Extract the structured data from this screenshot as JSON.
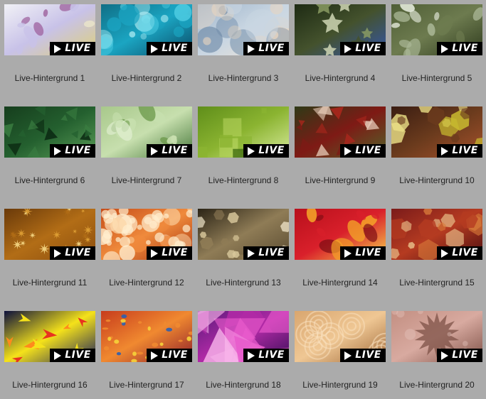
{
  "badge_label": "LIVE",
  "items": [
    {
      "label": "Live-Hintergrund 1",
      "theme": "pastel-leaves",
      "colors": [
        "#f1f1f6",
        "#c8c2e8",
        "#f0eccb",
        "#a26aa4",
        "#ddd07a"
      ]
    },
    {
      "label": "Live-Hintergrund 2",
      "theme": "cyan-bokeh",
      "colors": [
        "#0f6f86",
        "#1ba5c2",
        "#5ad6ea",
        "#bdf3f8",
        "#0a4a66"
      ]
    },
    {
      "label": "Live-Hintergrund 3",
      "theme": "blue-circles",
      "colors": [
        "#9fb5cb",
        "#c9d6e2",
        "#e8d5c0",
        "#6e8aa7",
        "#f3e6d6"
      ]
    },
    {
      "label": "Live-Hintergrund 4",
      "theme": "green-stars",
      "colors": [
        "#1e2b14",
        "#44522d",
        "#8a9b63",
        "#cfd6b4",
        "#3556a8"
      ]
    },
    {
      "label": "Live-Hintergrund 5",
      "theme": "olive-clovers",
      "colors": [
        "#4f5e36",
        "#6d7b4f",
        "#aab796",
        "#e4eadb",
        "#2f3b1e"
      ]
    },
    {
      "label": "Live-Hintergrund 6",
      "theme": "green-triangles",
      "colors": [
        "#163e1d",
        "#24602f",
        "#3a7d41",
        "#0b2912",
        "#5a9c57"
      ]
    },
    {
      "label": "Live-Hintergrund 7",
      "theme": "lime-leaves",
      "colors": [
        "#a8c88b",
        "#c7dfae",
        "#6d9a4c",
        "#e2efd2",
        "#46773a"
      ]
    },
    {
      "label": "Live-Hintergrund 8",
      "theme": "green-diamonds",
      "colors": [
        "#5f8e1a",
        "#8bb431",
        "#b4d35c",
        "#3e6b10",
        "#d7ea9b"
      ]
    },
    {
      "label": "Live-Hintergrund 9",
      "theme": "red-green-shards",
      "colors": [
        "#2e3a17",
        "#7e1a15",
        "#a9261c",
        "#e5c8b5",
        "#51642a"
      ]
    },
    {
      "label": "Live-Hintergrund 10",
      "theme": "brown-hexagons",
      "colors": [
        "#3a1d12",
        "#6b3b1d",
        "#c8ba2f",
        "#eadf86",
        "#a6522c"
      ]
    },
    {
      "label": "Live-Hintergrund 11",
      "theme": "gold-stars",
      "colors": [
        "#6a3a0a",
        "#b26d16",
        "#e4a437",
        "#fbe08d",
        "#8a4d0e"
      ]
    },
    {
      "label": "Live-Hintergrund 12",
      "theme": "orange-bokeh",
      "colors": [
        "#c44b18",
        "#ef8a3c",
        "#fcd6a6",
        "#ffeecf",
        "#a73510"
      ]
    },
    {
      "label": "Live-Hintergrund 13",
      "theme": "beige-flowers",
      "colors": [
        "#2b2416",
        "#8f7c56",
        "#d8c89b",
        "#f6ecd0",
        "#5a4b31"
      ]
    },
    {
      "label": "Live-Hintergrund 14",
      "theme": "red-leaves",
      "colors": [
        "#b8101c",
        "#d9202b",
        "#f3a128",
        "#7d0d14",
        "#f7d14d"
      ]
    },
    {
      "label": "Live-Hintergrund 15",
      "theme": "red-hexagons",
      "colors": [
        "#7b1b1a",
        "#b53b21",
        "#d87a3a",
        "#e6b985",
        "#4a0e10"
      ]
    },
    {
      "label": "Live-Hintergrund 16",
      "theme": "arrows",
      "colors": [
        "#0b0f3b",
        "#f5e21a",
        "#e8331f",
        "#ff8a1c",
        "#1a1f5c"
      ]
    },
    {
      "label": "Live-Hintergrund 17",
      "theme": "confetti",
      "colors": [
        "#c73c1c",
        "#f08930",
        "#2b5fb3",
        "#f6d33a",
        "#8c1d2a"
      ]
    },
    {
      "label": "Live-Hintergrund 18",
      "theme": "pink-polygons",
      "colors": [
        "#5a1a7a",
        "#b02aa6",
        "#e85bcc",
        "#f8b3ea",
        "#3a0f58"
      ]
    },
    {
      "label": "Live-Hintergrund 19",
      "theme": "peach-swirls",
      "colors": [
        "#d9a66f",
        "#efc794",
        "#b9814b",
        "#f9e0bd",
        "#a06a3a"
      ]
    },
    {
      "label": "Live-Hintergrund 20",
      "theme": "dusty-splat",
      "colors": [
        "#c38f82",
        "#d8aaa0",
        "#9a6a5e",
        "#e6c6be",
        "#7e5147"
      ]
    }
  ]
}
